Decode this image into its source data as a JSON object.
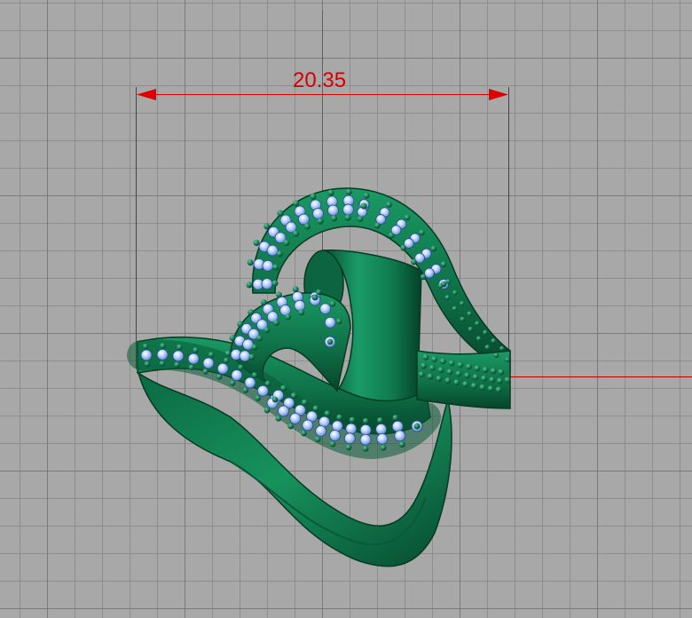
{
  "viewport": {
    "dimension_value": "20.35",
    "colors": {
      "background": "#a8a8a8",
      "grid_minor": "#8c8c8c",
      "grid_major": "#787878",
      "axis_x": "#c00000",
      "axis_y": "#00a000",
      "dimension": "#e00000",
      "metal": "#0f7a4e",
      "gem": "#b8d2ff"
    },
    "object": "ring-model"
  }
}
